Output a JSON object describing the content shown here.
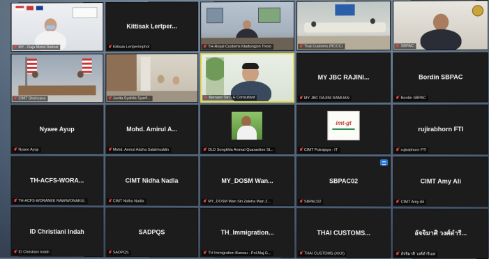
{
  "app": {
    "name": "Video conference gallery view"
  },
  "tiles": [
    {
      "name": "",
      "label": "MY - Raja Mohd Rafizal"
    },
    {
      "name": "Kittisak Lertper...",
      "label": "Kittisak Lertperimphol"
    },
    {
      "name": "",
      "label": "TH-Royal Customs Kladungjon Treso"
    },
    {
      "name": "",
      "label": "Thai Customs (RCCC)"
    },
    {
      "name": "",
      "label": "SBPAC"
    },
    {
      "name": "",
      "label": "CIMT Shahzana"
    },
    {
      "name": "",
      "label": "Junita Syahila Syarif..."
    },
    {
      "name": "",
      "label": "Bernard Tan - E Consultant"
    },
    {
      "name": "MY JBC RAJINI...",
      "label": "MY JBC RAJINI RAMUAN"
    },
    {
      "name": "Bordin SBPAC",
      "label": "Bordin SBPAC"
    },
    {
      "name": "Nyaee Ayup",
      "label": "Nyaee Ayup"
    },
    {
      "name": "Mohd. Amirul A...",
      "label": "Mohd. Amirul Adzha Salahhuddin"
    },
    {
      "name": "",
      "label": "DLD Songkhla Animal Quarantine St..."
    },
    {
      "name": "",
      "label": "CIMT Putrajaya - IT"
    },
    {
      "name": "rujirabhorn FTI",
      "label": "rujirabhorn FTI"
    },
    {
      "name": "TH-ACFS-WORA...",
      "label": "TH-ACFS-WORANEE RAWIWONAKUL"
    },
    {
      "name": "CIMT Nidha Nadia",
      "label": "CIMT Nidha Nadia"
    },
    {
      "name": "MY_DOSM Wan...",
      "label": "MY_DOSM Wan Siti Zaleha Wan Z..."
    },
    {
      "name": "SBPAC02",
      "label": "SBPAC02"
    },
    {
      "name": "CIMT Amy Ali",
      "label": "CIMT Amy Ali"
    },
    {
      "name": "ID Christiani Indah",
      "label": "ID Christiani Indah"
    },
    {
      "name": "SADPQS",
      "label": "SADPQS"
    },
    {
      "name": "TH_Immigration...",
      "label": "TH Immigration Bureau - Pol.Maj.G..."
    },
    {
      "name": "THAI CUSTOMS...",
      "label": "THAI CUSTOMS (XXX)"
    },
    {
      "name": "อัจจิมาศิ วงศ์ดำรี...",
      "label": "อัจจิมาศิ วงศ์ดำรีเอส"
    }
  ],
  "logo_tile": {
    "text": "imt-gt"
  },
  "colors": {
    "active_border": "#e8d84a",
    "muted_mic": "#e34646",
    "tile_bg": "#1c1c1c"
  },
  "icons": [
    "mic-muted-icon",
    "screen-share-icon"
  ]
}
